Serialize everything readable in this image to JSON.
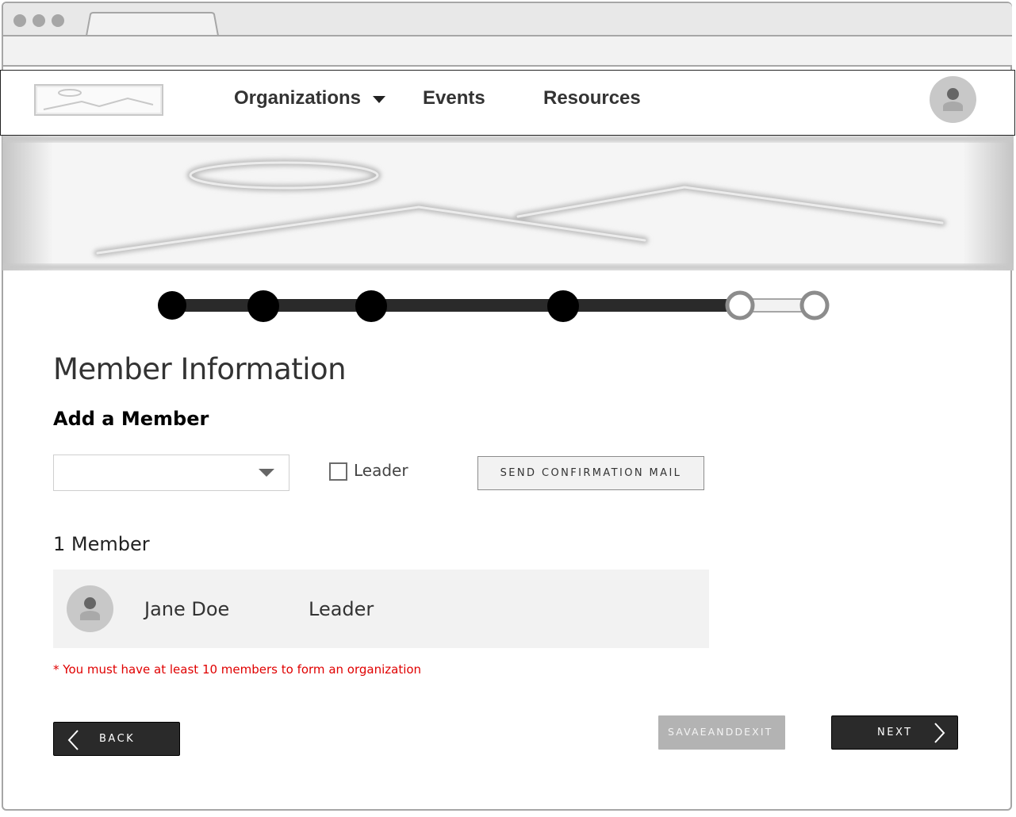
{
  "nav": {
    "items": [
      "Organizations",
      "Events",
      "Resources"
    ]
  },
  "stepper": {
    "total_steps": 6,
    "completed_steps": 4
  },
  "page": {
    "title": "Member Information",
    "section_title": "Add a Member"
  },
  "form": {
    "member_select_value": "",
    "leader_checkbox_label": "Leader",
    "leader_checked": false,
    "send_confirmation_label": "SEND CONFIRMATION MAIL"
  },
  "members": {
    "count_label": "1 Member",
    "list": [
      {
        "name": "Jane Doe",
        "role": "Leader"
      }
    ]
  },
  "warning": "* You must have at least 10 members to form an organization",
  "actions": {
    "back_label": "BACK",
    "save_exit_label": "SAVAEANDDEXIT",
    "next_label": "NEXT"
  },
  "colors": {
    "primary_dark": "#2a2a2a",
    "disabled_gray": "#b3b3b3",
    "warning_red": "#e00000"
  },
  "icons": {
    "logo": "image-placeholder-icon",
    "user_avatar": "user-icon",
    "nav_dropdown": "caret-down-icon",
    "back": "chevron-left-icon",
    "next": "chevron-right-icon"
  }
}
